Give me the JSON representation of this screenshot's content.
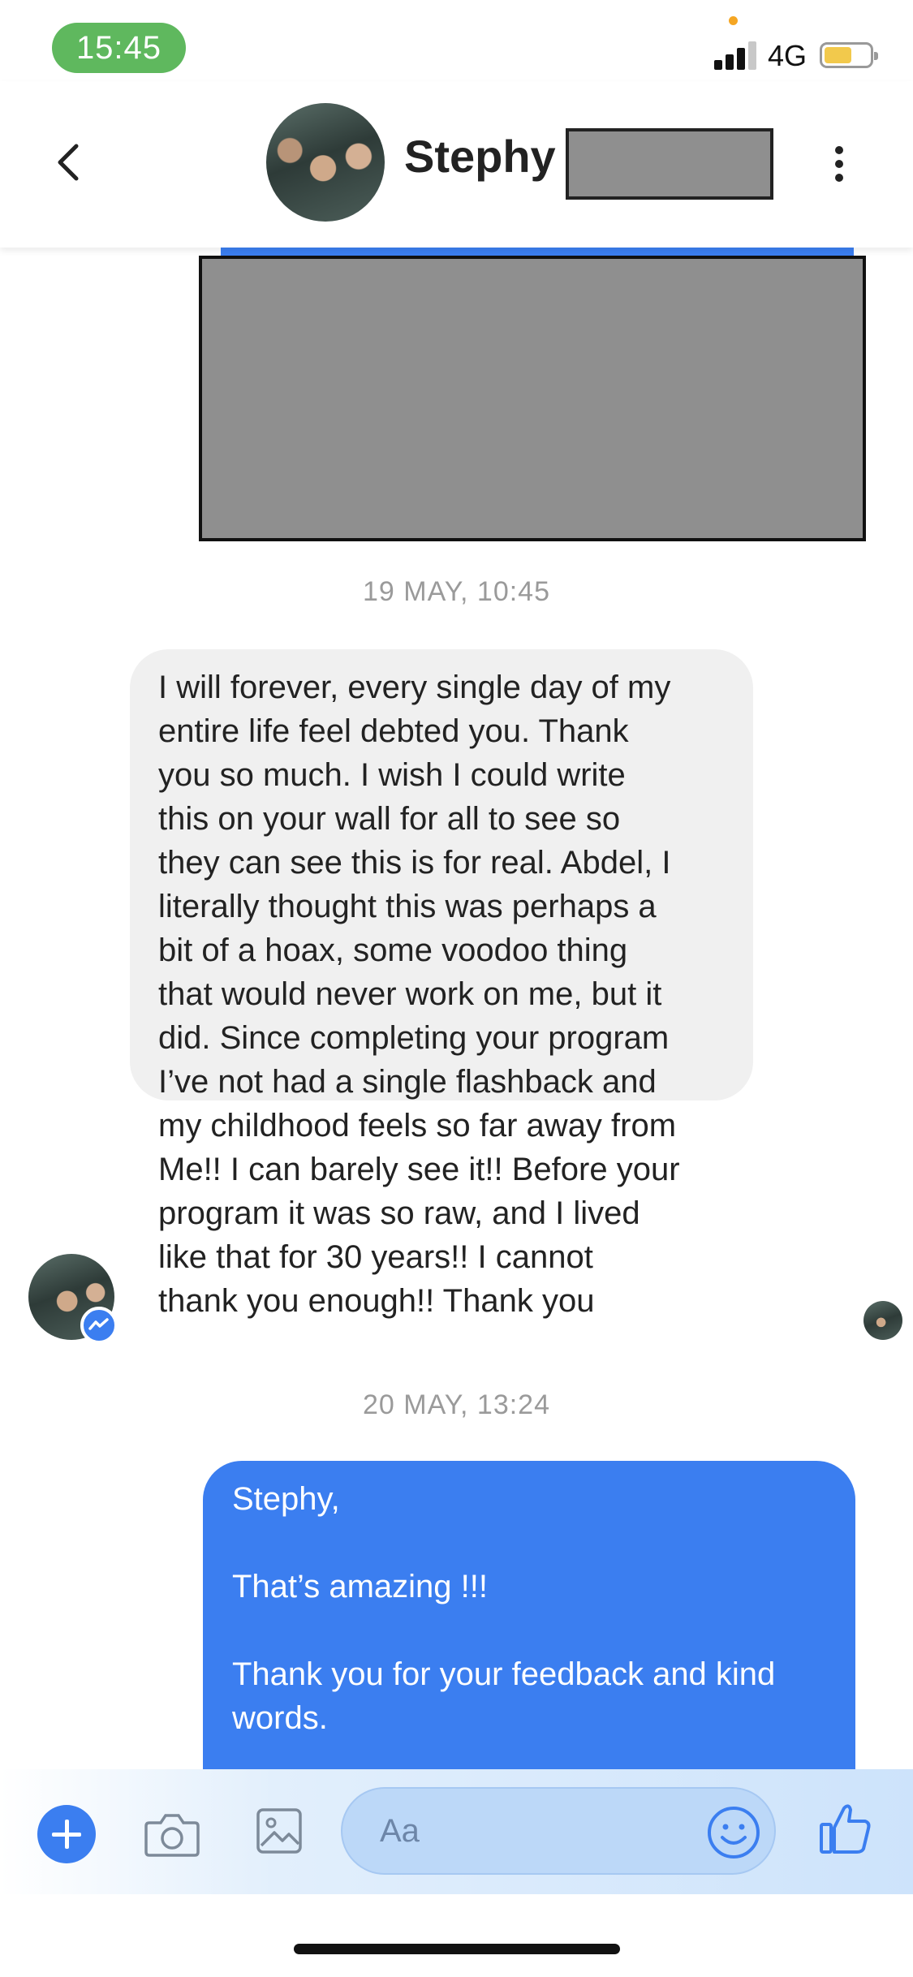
{
  "status_bar": {
    "time": "15:45",
    "network": "4G",
    "battery_level": 0.55
  },
  "header": {
    "contact_name": "Stephy",
    "back_icon": "chevron-left-icon",
    "menu_icon": "more-vertical-icon"
  },
  "messages": [
    {
      "timestamp": "19 MAY, 10:45",
      "sender": "contact",
      "text": "I will forever, every single day of my\nentire life feel debted you. Thank\nyou so much. I wish I could write\nthis on your wall for all to see so\nthey can see this is for real. Abdel, I\nliterally thought this was perhaps a\nbit of a hoax, some voodoo thing\nthat would never work on me, but it\ndid. Since completing your program\nI’ve not had a single flashback and\nmy childhood feels so far away from\nMe!! I can barely see it!! Before your\nprogram it was so raw, and I lived\nlike that for 30 years!! I cannot\nthank you enough!! Thank you"
    },
    {
      "timestamp": "20 MAY, 13:24",
      "sender": "me",
      "text": "Stephy,\n\nThat’s amazing !!!\n\nThank you for your feedback and kind\nwords."
    }
  ],
  "composer": {
    "placeholder": "Aa",
    "icons": [
      "plus-icon",
      "camera-icon",
      "gallery-icon",
      "emoji-icon",
      "thumbs-up-icon"
    ]
  },
  "colors": {
    "accent": "#3b7ef0",
    "status_pill": "#5fb85e",
    "incoming_bubble": "#f0f0f0",
    "timestamp_text": "#9a9a9a"
  }
}
